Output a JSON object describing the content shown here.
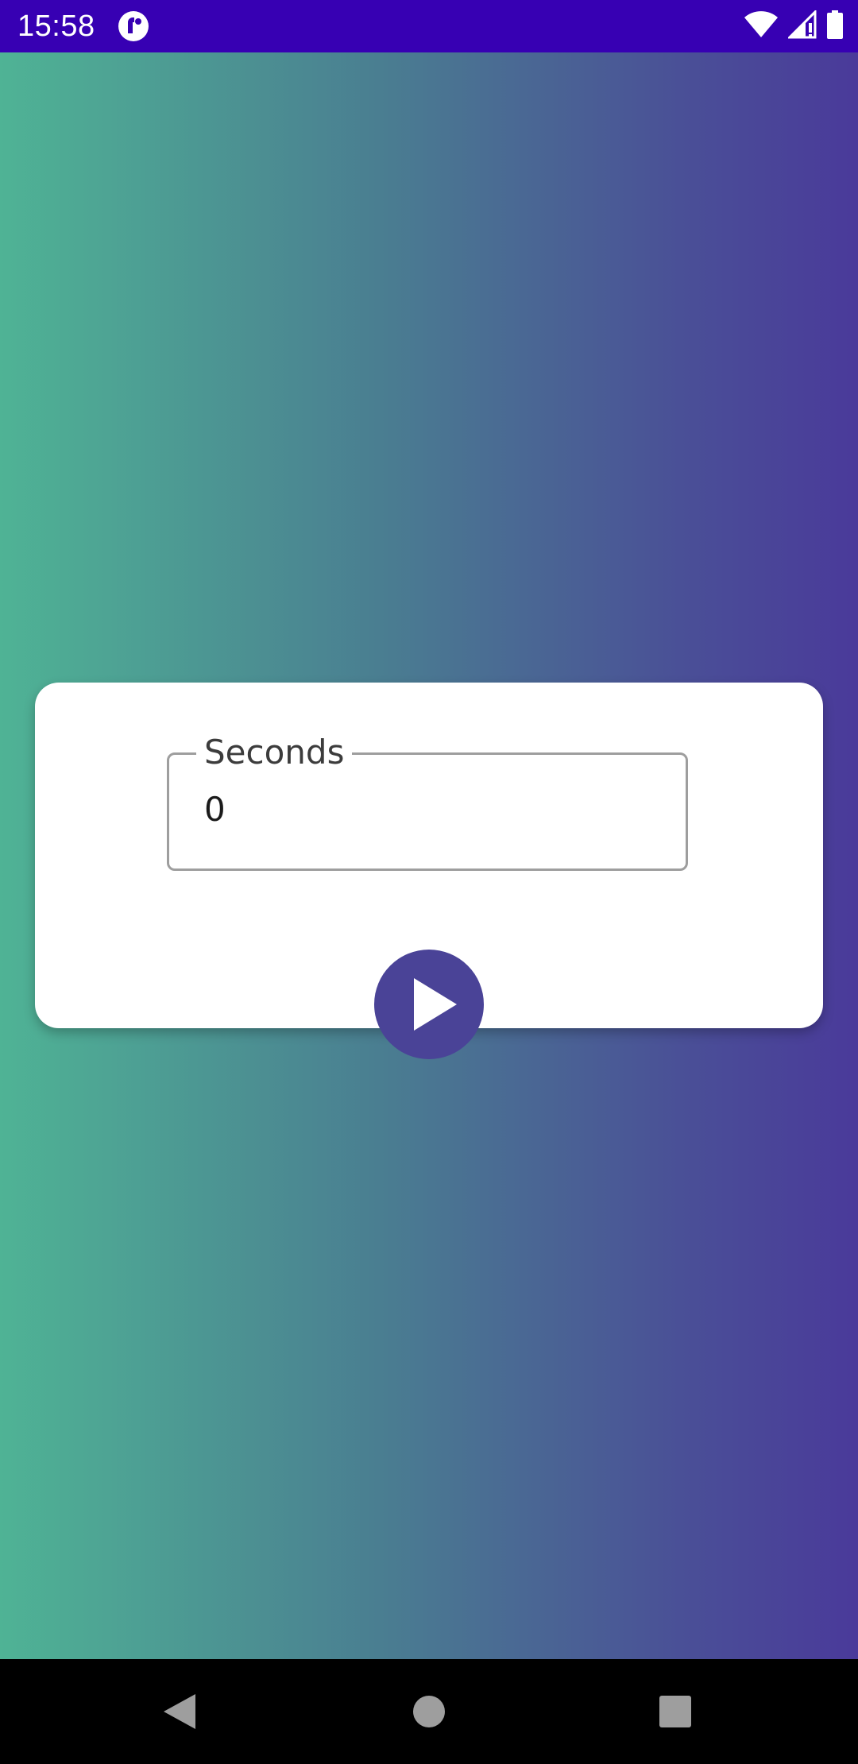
{
  "status_bar": {
    "time": "15:58",
    "app_icon": "app-notification-icon",
    "right_icons": [
      "wifi-icon",
      "cell-signal-icon",
      "battery-icon"
    ]
  },
  "colors": {
    "status_bar": "#3700b3",
    "gradient_start": "#4fb395",
    "gradient_end": "#4a3a9a",
    "accent": "#4a4397"
  },
  "timer": {
    "field_label": "Seconds",
    "field_value": "0",
    "start_button_icon": "play-icon"
  },
  "nav_bar": {
    "buttons": [
      "back-icon",
      "home-icon",
      "recents-icon"
    ]
  }
}
